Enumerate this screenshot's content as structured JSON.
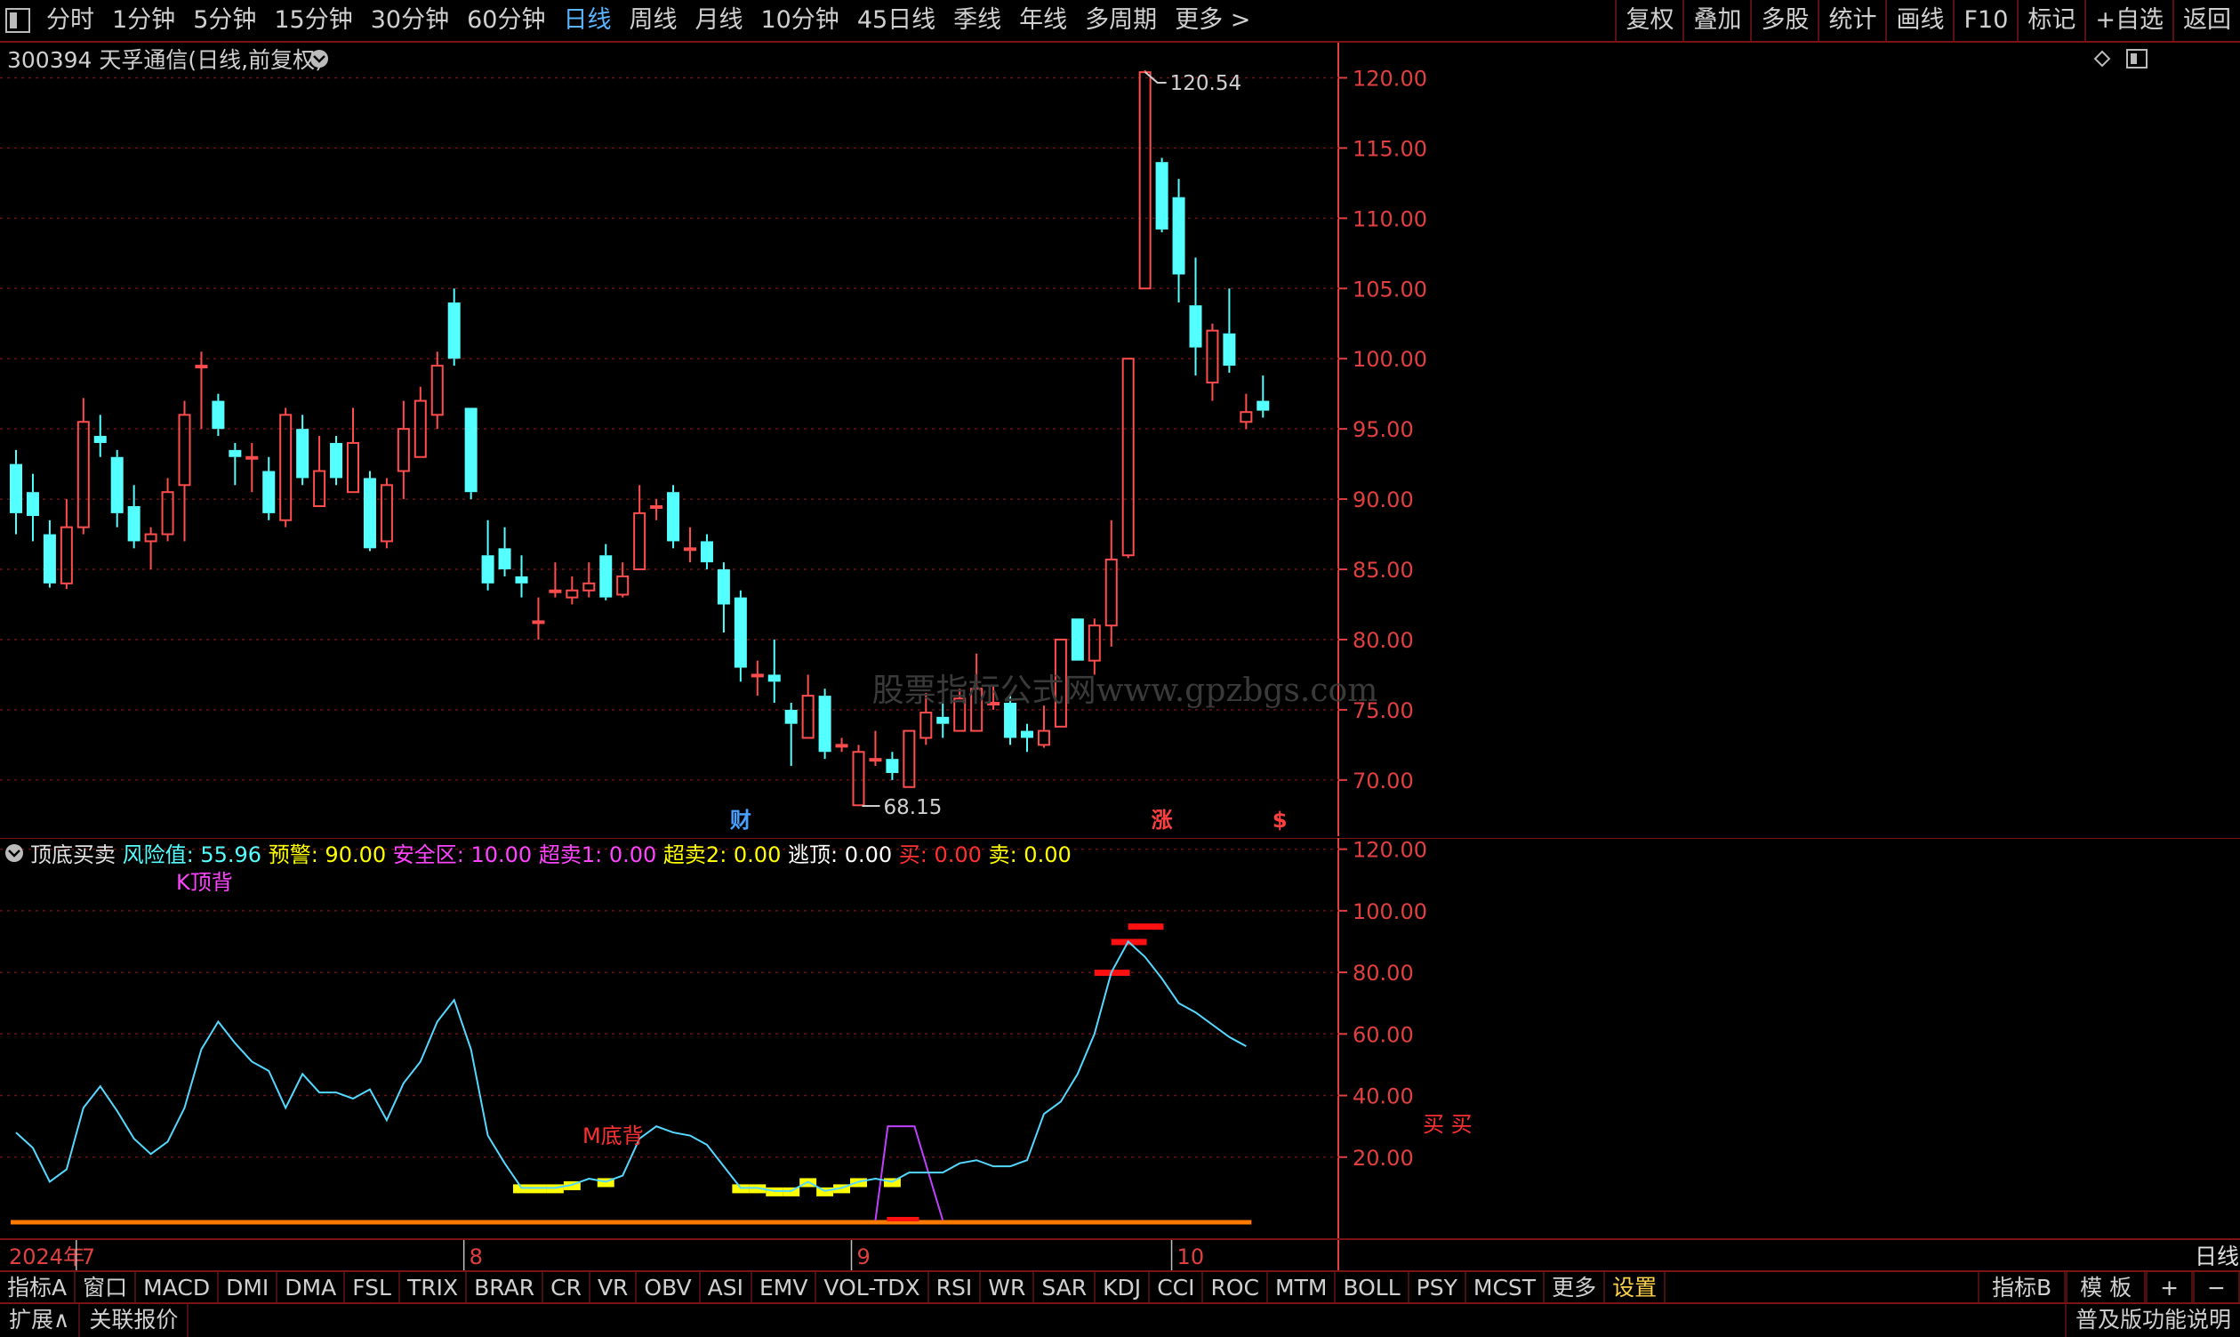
{
  "toolbar": {
    "periods": [
      "分时",
      "1分钟",
      "5分钟",
      "15分钟",
      "30分钟",
      "60分钟",
      "日线",
      "周线",
      "月线",
      "10分钟",
      "45日线",
      "季线",
      "年线",
      "多周期",
      "更多 >"
    ],
    "active_period": "日线",
    "right_tools": [
      "复权",
      "叠加",
      "多股",
      "统计",
      "画线",
      "F10",
      "标记",
      "+自选",
      "返回"
    ]
  },
  "main_chart": {
    "stock_title": "300394 天孚通信(日线,前复权)",
    "high_label": "120.54",
    "low_label": "68.15",
    "watermark": "股票指标公式网www.gpzbgs.com",
    "event_markers": [
      {
        "text": "财",
        "index": 43,
        "color": "#4aa0ff"
      },
      {
        "text": "涨",
        "index": 68,
        "color": "#ff4040"
      },
      {
        "text": "$",
        "index": 75,
        "color": "#ff4040"
      }
    ],
    "colors": {
      "up": "#ff4d4d",
      "down": "#54ffff",
      "grid": "#6a1212",
      "axis": "#e04040"
    }
  },
  "chart_data": {
    "type": "candlestick",
    "y_ticks": [
      70,
      75,
      80,
      85,
      90,
      95,
      100,
      105,
      110,
      115,
      120
    ],
    "ylim": [
      66,
      122.5
    ],
    "candles": [
      [
        92.5,
        89,
        93.5,
        87.5
      ],
      [
        90.5,
        88.8,
        91.8,
        87
      ],
      [
        87.5,
        84,
        88.5,
        83.7
      ],
      [
        84,
        88,
        90,
        83.6
      ],
      [
        88,
        95.5,
        97.2,
        87.5
      ],
      [
        94.5,
        94,
        96,
        93
      ],
      [
        93,
        89,
        93.5,
        88
      ],
      [
        89.5,
        87,
        91,
        86.5
      ],
      [
        87,
        87.5,
        88,
        85
      ],
      [
        87.5,
        90.5,
        91.5,
        87
      ],
      [
        91,
        96,
        97,
        87
      ],
      [
        99.5,
        99.5,
        100.5,
        95
      ],
      [
        97,
        95,
        97.5,
        94.5
      ],
      [
        93.5,
        93,
        94,
        91
      ],
      [
        93,
        93,
        94,
        90.5
      ],
      [
        92,
        89,
        93,
        88.5
      ],
      [
        88.5,
        96,
        96.5,
        88
      ],
      [
        95,
        91.5,
        96,
        91
      ],
      [
        89.5,
        92,
        94.5,
        89.5
      ],
      [
        94,
        91.5,
        94.5,
        91
      ],
      [
        90.5,
        94,
        96.5,
        90.5
      ],
      [
        91.5,
        86.5,
        92,
        86.3
      ],
      [
        87,
        91,
        91.5,
        86.5
      ],
      [
        92,
        95,
        97,
        90
      ],
      [
        93,
        97,
        98,
        93
      ],
      [
        96,
        99.5,
        100.5,
        95
      ],
      [
        104,
        100,
        105,
        99.5
      ],
      [
        96.5,
        90.5,
        96.5,
        90
      ],
      [
        86,
        84,
        88.5,
        83.5
      ],
      [
        86.5,
        85,
        88,
        84.5
      ],
      [
        84.5,
        84,
        86,
        83
      ],
      [
        81.3,
        81.3,
        83,
        80
      ],
      [
        83.5,
        83.5,
        85.5,
        83
      ],
      [
        83,
        83.5,
        84.5,
        82.5
      ],
      [
        83.5,
        84,
        85.5,
        83
      ],
      [
        86,
        83,
        86.8,
        82.8
      ],
      [
        83.2,
        84.5,
        85.5,
        83
      ],
      [
        85,
        89,
        91,
        85
      ],
      [
        89.5,
        89.5,
        90,
        88.5
      ],
      [
        90.5,
        87,
        91,
        86.5
      ],
      [
        86.5,
        86.5,
        88,
        85.5
      ],
      [
        87,
        85.5,
        87.5,
        85
      ],
      [
        85,
        82.5,
        85.5,
        80.5
      ],
      [
        83,
        78,
        83.5,
        77
      ],
      [
        77.5,
        77.5,
        78.5,
        76
      ],
      [
        77.5,
        77,
        80,
        75.5
      ],
      [
        75,
        74,
        75.5,
        71
      ],
      [
        73,
        76,
        77.5,
        73
      ],
      [
        76,
        72,
        76.5,
        71.5
      ],
      [
        72.5,
        72.5,
        73,
        72
      ],
      [
        68.2,
        72,
        72.5,
        68.15
      ],
      [
        71.5,
        71.5,
        73.5,
        71
      ],
      [
        71.5,
        70.5,
        72,
        70
      ],
      [
        69.5,
        73.5,
        73.5,
        69.5
      ],
      [
        73,
        74.8,
        76.2,
        72.5
      ],
      [
        74.5,
        74,
        75.5,
        73
      ],
      [
        73.5,
        75.8,
        76.5,
        73.5
      ],
      [
        73.5,
        76.5,
        79,
        73.5
      ],
      [
        75.5,
        75.5,
        76.8,
        75
      ],
      [
        75.5,
        73,
        76,
        72.5
      ],
      [
        73.5,
        73,
        74,
        72
      ],
      [
        72.5,
        73.5,
        75.3,
        72.3
      ],
      [
        73.8,
        80,
        80,
        73.8
      ],
      [
        81.5,
        78.5,
        81.5,
        78.5
      ],
      [
        78.5,
        81,
        81.5,
        77.5
      ],
      [
        81,
        85.7,
        88.5,
        79.5
      ],
      [
        86,
        100,
        100,
        85.8
      ],
      [
        105,
        120.4,
        120.54,
        105
      ],
      [
        114,
        109.2,
        114.3,
        109
      ],
      [
        111.5,
        106,
        112.8,
        104
      ],
      [
        103.8,
        100.8,
        107.2,
        98.8
      ],
      [
        98.3,
        102,
        102.5,
        97
      ],
      [
        101.8,
        99.5,
        105,
        99
      ],
      [
        95.5,
        96.2,
        97.5,
        95
      ],
      [
        97,
        96.3,
        98.8,
        95.8
      ]
    ]
  },
  "indicator": {
    "title": "顶底买卖",
    "params": [
      {
        "label": "风险值",
        "value": "55.96",
        "color": "#54ffff"
      },
      {
        "label": "预警",
        "value": "90.00",
        "color": "#ffff00"
      },
      {
        "label": "安全区",
        "value": "10.00",
        "color": "#ff44ff"
      },
      {
        "label": "超卖1",
        "value": "0.00",
        "color": "#ff44ff"
      },
      {
        "label": "超卖2",
        "value": "0.00",
        "color": "#ffff00"
      },
      {
        "label": "逃顶",
        "value": "0.00",
        "color": "#ffffff"
      },
      {
        "label": "买",
        "value": "0.00",
        "color": "#ff3030"
      },
      {
        "label": "卖",
        "value": "0.00",
        "color": "#ffff00"
      }
    ],
    "annotations": [
      {
        "text": "K顶背",
        "color": "#ff44ff"
      },
      {
        "text": "M底背",
        "color": "#ff3030"
      },
      {
        "text": "买 买",
        "color": "#ff3030"
      }
    ],
    "y_ticks": [
      20,
      40,
      60,
      80,
      100,
      120
    ],
    "risk_values": [
      28,
      23,
      12,
      16,
      36,
      43,
      35,
      26,
      21,
      25,
      36,
      55,
      64,
      57,
      51,
      48,
      36,
      47,
      41,
      41,
      39,
      42,
      32,
      44,
      51,
      64,
      71,
      55,
      27,
      18,
      10,
      10,
      10,
      11,
      13,
      12,
      14,
      26,
      30,
      28,
      27,
      24,
      17,
      10,
      10,
      9,
      9,
      12,
      9,
      10,
      12,
      13,
      12,
      15,
      15,
      15,
      18,
      19,
      17,
      17,
      19,
      34,
      38,
      47,
      60,
      80,
      90,
      85,
      78,
      70,
      67,
      63,
      59,
      56
    ]
  },
  "x_axis": {
    "labels": [
      {
        "text": "2024年",
        "index": 0
      },
      {
        "text": "7",
        "index": 4
      },
      {
        "text": "8",
        "index": 27
      },
      {
        "text": "9",
        "index": 50
      },
      {
        "text": "10",
        "index": 69
      }
    ],
    "right_label": "日线"
  },
  "tabs": [
    "指标A",
    "窗口",
    "MACD",
    "DMI",
    "DMA",
    "FSL",
    "TRIX",
    "BRAR",
    "CR",
    "VR",
    "OBV",
    "ASI",
    "EMV",
    "VOL-TDX",
    "RSI",
    "WR",
    "SAR",
    "KDJ",
    "CCI",
    "ROC",
    "MTM",
    "BOLL",
    "PSY",
    "MCST",
    "更多",
    "设置"
  ],
  "active_tab": "设置",
  "tabs_right": [
    "指标B",
    "模 板",
    "+",
    "−"
  ],
  "statusbar": {
    "left": [
      "扩展∧",
      "关联报价"
    ],
    "right": "普及版功能说明"
  }
}
